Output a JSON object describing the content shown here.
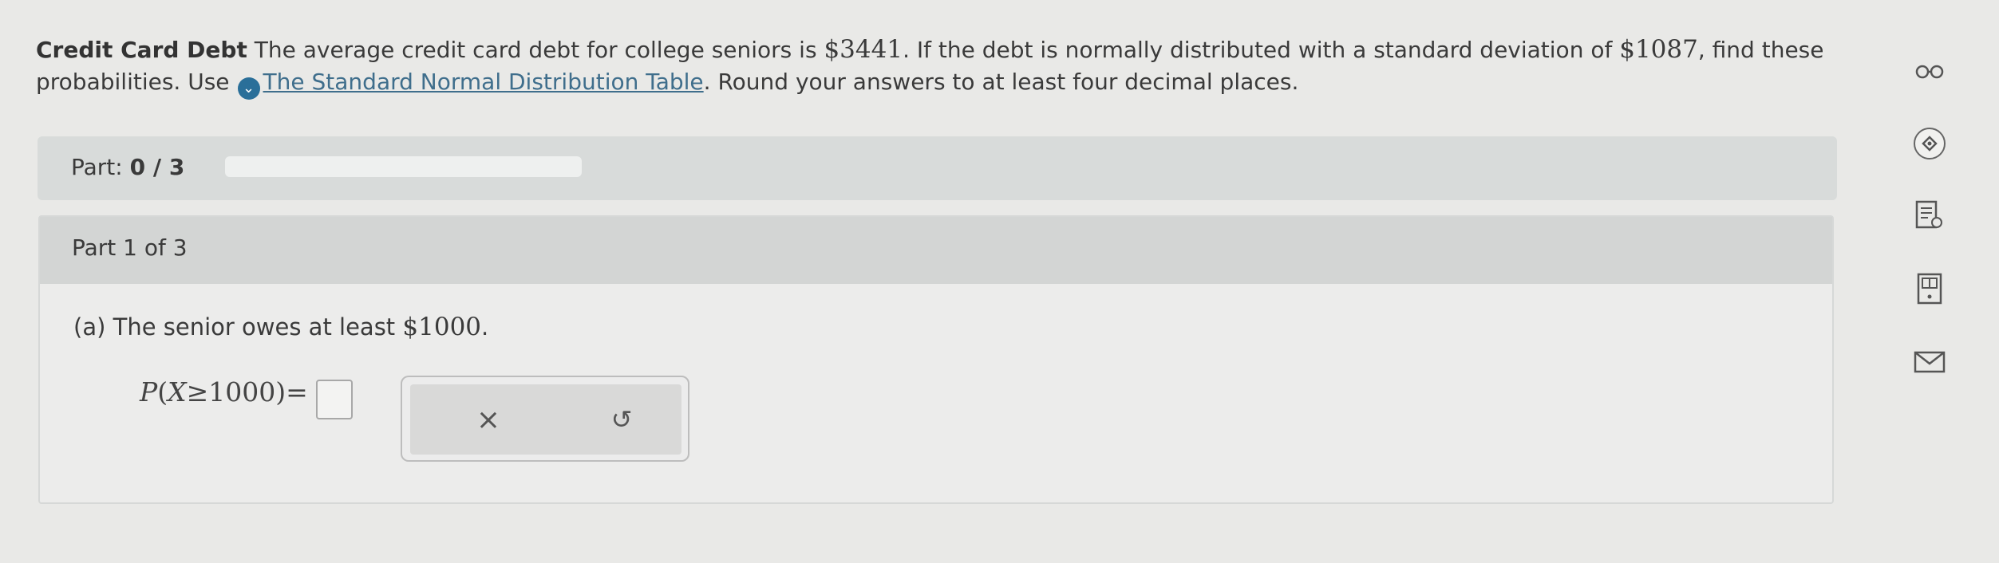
{
  "problem": {
    "title": "Credit Card Debt",
    "text1": "The average credit card debt for college seniors is",
    "mean": "$3441",
    "text2": ". If the debt is normally distributed with a standard deviation of",
    "sd": "$1087",
    "text3": ", find these probabilities. Use",
    "link": "The Standard Normal Distribution Table",
    "text4": ". Round your answers to at least four decimal places."
  },
  "progress_bar": {
    "label": "Part:",
    "value": "0 / 3",
    "fraction": 0
  },
  "part": {
    "header": "Part 1 of 3",
    "question_prefix": "(a) The senior owes at least",
    "question_value": "$1000",
    "question_suffix": ".",
    "eq_p": "P",
    "eq_var": "X",
    "eq_rel": "≥",
    "eq_num": "1000",
    "eq_equals": "="
  },
  "tools": {
    "clear_icon": "×",
    "undo_icon": "↺"
  },
  "sidebar": [
    "glasses-icon",
    "tag-icon",
    "notes-icon",
    "calculator-icon",
    "mail-icon"
  ]
}
